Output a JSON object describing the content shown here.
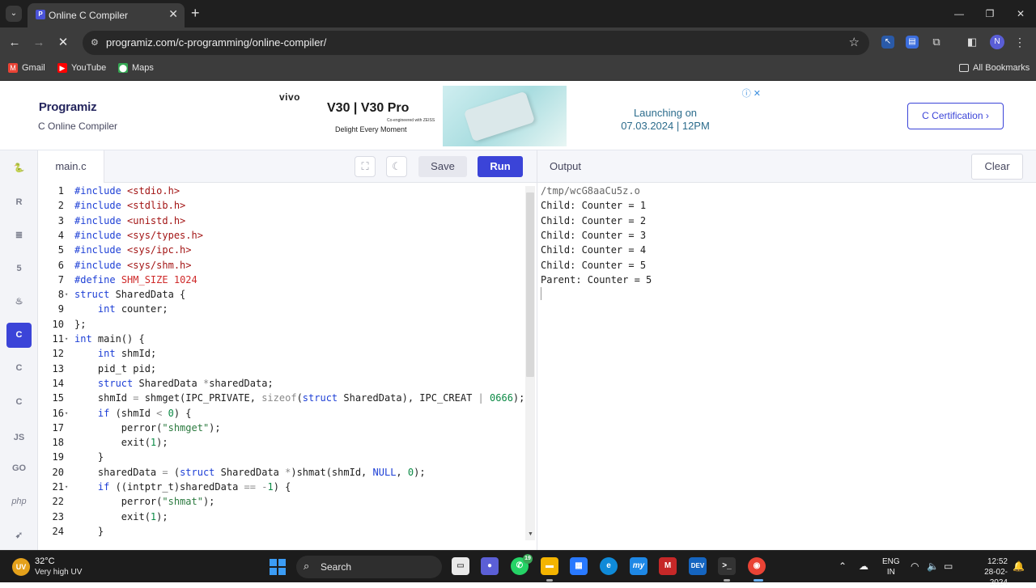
{
  "browser": {
    "tab_title": "Online C Compiler",
    "url": "programiz.com/c-programming/online-compiler/",
    "bookmarks": [
      {
        "label": "Gmail",
        "icon": "gmail-icon",
        "color": "#ea4335"
      },
      {
        "label": "YouTube",
        "icon": "youtube-icon",
        "color": "#ff0000"
      },
      {
        "label": "Maps",
        "icon": "maps-icon",
        "color": "#34a853"
      }
    ],
    "all_bookmarks": "All Bookmarks",
    "profile_initial": "N"
  },
  "header": {
    "logo": "Programiz",
    "subtitle": "C Online Compiler",
    "certification_button": "C Certification ›"
  },
  "ad": {
    "brand": "vivo",
    "title": "V30 | V30 Pro",
    "co_engineered": "Co-engineered with ZEISS",
    "tagline": "Delight Every Moment",
    "launch_line1": "Launching on",
    "launch_line2": "07.03.2024 | 12PM"
  },
  "languages": [
    {
      "name": "python-lang",
      "glyph": "🐍",
      "active": false
    },
    {
      "name": "r-lang",
      "glyph": "R",
      "active": false
    },
    {
      "name": "sql-lang",
      "glyph": "≣",
      "active": false
    },
    {
      "name": "html-lang",
      "glyph": "5",
      "active": false
    },
    {
      "name": "java-lang",
      "glyph": "♨",
      "active": false
    },
    {
      "name": "c-lang",
      "glyph": "C",
      "active": true
    },
    {
      "name": "cpp-lang",
      "glyph": "C",
      "active": false
    },
    {
      "name": "csharp-lang",
      "glyph": "C",
      "active": false
    },
    {
      "name": "js-lang",
      "glyph": "JS",
      "active": false
    },
    {
      "name": "go-lang",
      "glyph": "GO",
      "active": false
    },
    {
      "name": "php-lang",
      "glyph": "php",
      "active": false
    },
    {
      "name": "swift-lang",
      "glyph": "➹",
      "active": false
    }
  ],
  "editor": {
    "filename": "main.c",
    "save_label": "Save",
    "run_label": "Run",
    "lines": [
      {
        "n": "1",
        "fold": "",
        "html": "<span class='kw'>#include</span> <span class='str'>&lt;stdio.h&gt;</span>"
      },
      {
        "n": "2",
        "fold": "",
        "html": "<span class='kw'>#include</span> <span class='str'>&lt;stdlib.h&gt;</span>"
      },
      {
        "n": "3",
        "fold": "",
        "html": "<span class='kw'>#include</span> <span class='str'>&lt;unistd.h&gt;</span>"
      },
      {
        "n": "4",
        "fold": "",
        "html": "<span class='kw'>#include</span> <span class='str'>&lt;sys/types.h&gt;</span>"
      },
      {
        "n": "5",
        "fold": "",
        "html": "<span class='kw'>#include</span> <span class='str'>&lt;sys/ipc.h&gt;</span>"
      },
      {
        "n": "6",
        "fold": "",
        "html": "<span class='kw'>#include</span> <span class='str'>&lt;sys/shm.h&gt;</span>"
      },
      {
        "n": "7",
        "fold": "",
        "html": "<span class='kw'>#define</span> <span class='mac'>SHM_SIZE</span> <span class='mac'>1024</span>"
      },
      {
        "n": "8",
        "fold": "▾",
        "html": "<span class='kw'>struct</span> SharedData {"
      },
      {
        "n": "9",
        "fold": "",
        "html": "    <span class='kw'>int</span> counter;"
      },
      {
        "n": "10",
        "fold": "",
        "html": "};"
      },
      {
        "n": "11",
        "fold": "▾",
        "html": "<span class='kw'>int</span> main() {"
      },
      {
        "n": "12",
        "fold": "",
        "html": "    <span class='kw'>int</span> shmId;"
      },
      {
        "n": "13",
        "fold": "",
        "html": "    pid_t pid;"
      },
      {
        "n": "14",
        "fold": "",
        "html": "    <span class='kw'>struct</span> SharedData <span class='op'>*</span>sharedData;"
      },
      {
        "n": "15",
        "fold": "",
        "html": "    shmId <span class='op'>=</span> shmget(IPC_PRIVATE, <span class='op'>sizeof</span>(<span class='kw'>struct</span> SharedData), IPC_CREAT <span class='op'>|</span> <span class='num'>0666</span>);"
      },
      {
        "n": "16",
        "fold": "▾",
        "html": "    <span class='kw'>if</span> (shmId <span class='op'>&lt;</span> <span class='num'>0</span>) {"
      },
      {
        "n": "17",
        "fold": "",
        "html": "        perror(<span class='sg'>\"shmget\"</span>);"
      },
      {
        "n": "18",
        "fold": "",
        "html": "        exit(<span class='num'>1</span>);"
      },
      {
        "n": "19",
        "fold": "",
        "html": "    }"
      },
      {
        "n": "20",
        "fold": "",
        "html": "    sharedData <span class='op'>=</span> (<span class='kw'>struct</span> SharedData <span class='op'>*</span>)shmat(shmId, <span class='kw'>NULL</span>, <span class='num'>0</span>);"
      },
      {
        "n": "21",
        "fold": "▾",
        "html": "    <span class='kw'>if</span> ((intptr_t)sharedData <span class='op'>==</span> <span class='op'>-</span><span class='num'>1</span>) {"
      },
      {
        "n": "22",
        "fold": "",
        "html": "        perror(<span class='sg'>\"shmat\"</span>);"
      },
      {
        "n": "23",
        "fold": "",
        "html": "        exit(<span class='num'>1</span>);"
      },
      {
        "n": "24",
        "fold": "",
        "html": "    }"
      }
    ]
  },
  "output": {
    "title": "Output",
    "clear_label": "Clear",
    "lines": [
      "/tmp/wcG8aaCu5z.o",
      "Child: Counter = 1",
      "Child: Counter = 2",
      "Child: Counter = 3",
      "Child: Counter = 4",
      "Child: Counter = 5",
      "Parent: Counter = 5"
    ]
  },
  "taskbar": {
    "temperature": "32°C",
    "weather_desc": "Very high UV",
    "uv_badge": "UV",
    "search_label": "Search",
    "lang_line1": "ENG",
    "lang_line2": "IN",
    "time": "12:52",
    "date": "28-02-2024",
    "whatsapp_badge": "19"
  }
}
